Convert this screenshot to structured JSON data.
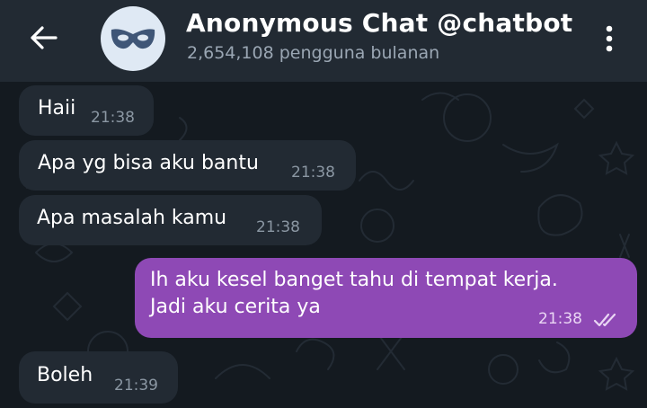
{
  "header": {
    "back_icon": "arrow-left-icon",
    "avatar_icon": "mask-icon",
    "title": "Anonymous Chat @chatbot",
    "subtitle": "2,654,108 pengguna bulanan",
    "menu_icon": "more-vertical-icon"
  },
  "messages": [
    {
      "direction": "in",
      "text": "Haii",
      "time": "21:38"
    },
    {
      "direction": "in",
      "text": "Apa yg bisa aku bantu",
      "time": "21:38"
    },
    {
      "direction": "in",
      "text": "Apa masalah kamu",
      "time": "21:38"
    },
    {
      "direction": "out",
      "lines": [
        "Ih aku kesel banget tahu di tempat kerja.",
        "Jadi aku cerita ya"
      ],
      "time": "21:38",
      "status": "read"
    },
    {
      "direction": "in",
      "text": "Boleh",
      "time": "21:39"
    }
  ],
  "colors": {
    "header_bg": "#222a33",
    "wallpaper_bg": "#141a20",
    "incoming_bubble": "#222a33",
    "outgoing_bubble": "#8e49b5"
  }
}
